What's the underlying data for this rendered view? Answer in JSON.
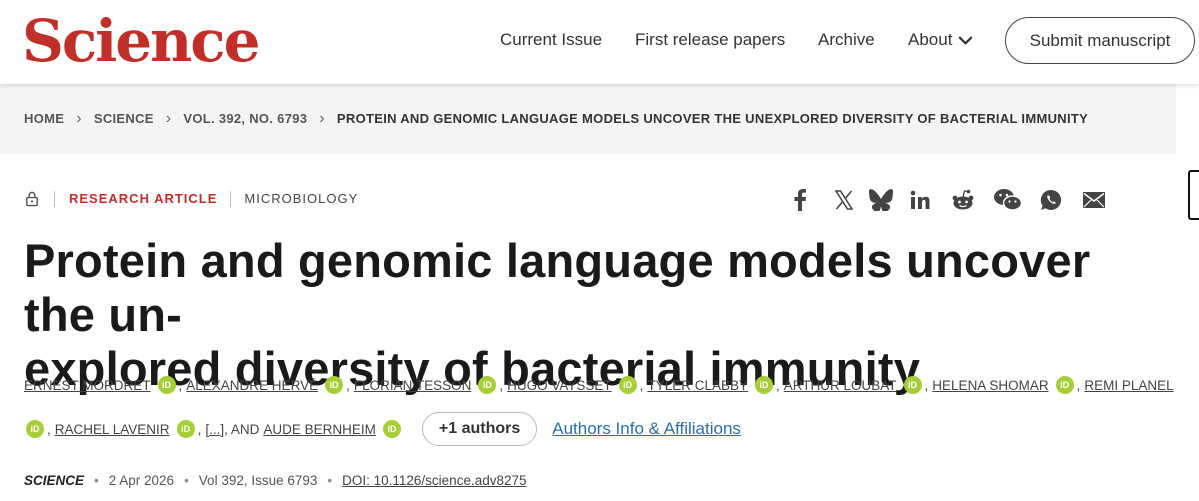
{
  "header": {
    "logo": "Science",
    "nav": {
      "current_issue": "Current Issue",
      "first_release": "First release papers",
      "archive": "Archive",
      "about": "About"
    },
    "submit": "Submit manuscript"
  },
  "breadcrumb": {
    "home": "HOME",
    "science": "SCIENCE",
    "volume": "VOL. 392, NO. 6793",
    "current": "PROTEIN AND GENOMIC LANGUAGE MODELS UNCOVER THE UNEXPLORED DIVERSITY OF BACTERIAL IMMUNITY"
  },
  "article": {
    "type": "RESEARCH ARTICLE",
    "subject": "MICROBIOLOGY",
    "title_line1": "Protein and genomic language models uncover the un-",
    "title_line2": "explored diversity of bacterial immunity"
  },
  "share_icons": [
    "facebook-icon",
    "x-icon",
    "bluesky-icon",
    "linkedin-icon",
    "reddit-icon",
    "wechat-icon",
    "whatsapp-icon",
    "email-icon"
  ],
  "authors": {
    "row1": [
      "ERNEST MORDRET",
      "ALEXANDRE HERVÉ",
      "FLORIAN TESSON",
      "HUGO VAYSSET",
      "TYLER CLABBY",
      "ARTHUR LOUBAT",
      "HELENA SHOMAR",
      "REMI PLANEL"
    ],
    "row2": [
      "RACHEL LAVENIR"
    ],
    "ellipsis": "[...]",
    "and": ", AND",
    "last": "AUDE BERNHEIM",
    "orcid_label": "iD",
    "more_button": "+1 authors",
    "affiliations_link": "Authors Info & Affiliations"
  },
  "citation": {
    "journal": "SCIENCE",
    "date": "2 Apr 2026",
    "volume": "Vol 392, Issue 6793",
    "doi": "DOI: 10.1126/science.adv8275"
  },
  "colors": {
    "brand_red": "#c02f2a",
    "orcid_green": "#a6ce39",
    "link_blue": "#2a6ea8"
  }
}
